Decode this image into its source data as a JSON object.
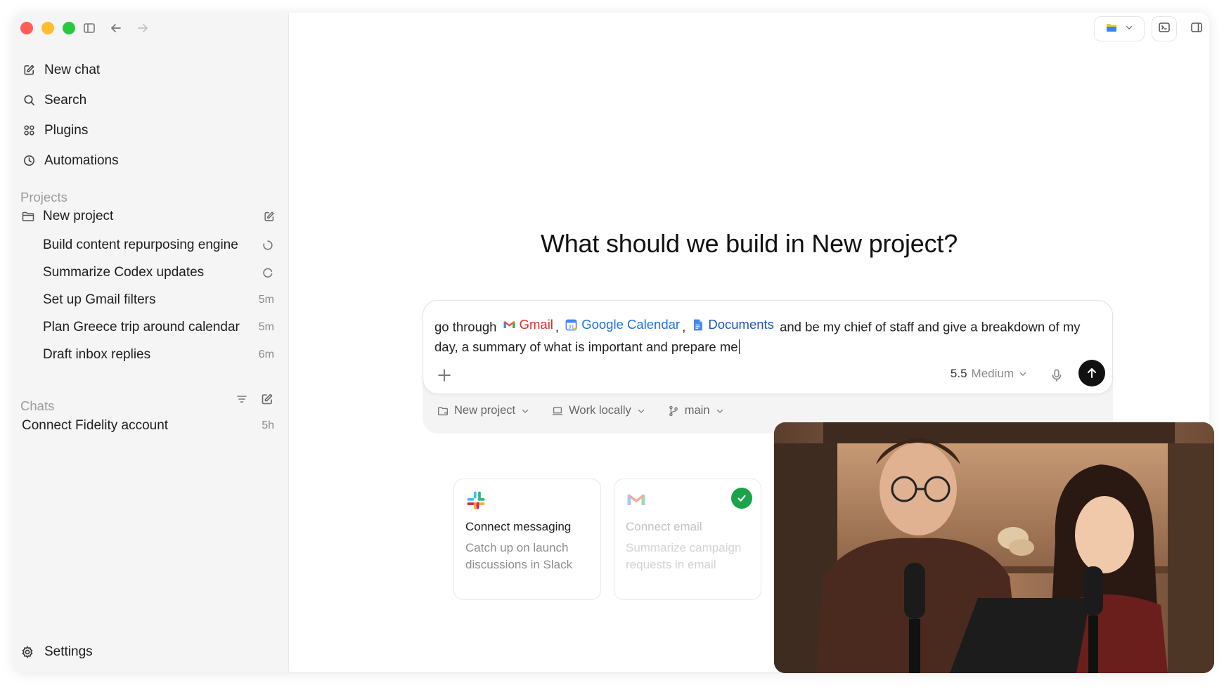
{
  "sidebar": {
    "nav": [
      {
        "label": "New chat",
        "icon": "compose-icon"
      },
      {
        "label": "Search",
        "icon": "search-icon"
      },
      {
        "label": "Plugins",
        "icon": "plugins-icon"
      },
      {
        "label": "Automations",
        "icon": "clock-icon"
      }
    ],
    "projects_label": "Projects",
    "project_name": "New project",
    "project_items": [
      {
        "label": "Build content repurposing engine",
        "meta": ""
      },
      {
        "label": "Summarize Codex updates",
        "meta": ""
      },
      {
        "label": "Set up Gmail filters",
        "meta": "5m"
      },
      {
        "label": "Plan Greece trip around calendar",
        "meta": "5m"
      },
      {
        "label": "Draft inbox replies",
        "meta": "6m"
      }
    ],
    "chats_label": "Chats",
    "chat_items": [
      {
        "label": "Connect Fidelity account",
        "meta": "5h"
      }
    ],
    "settings_label": "Settings"
  },
  "main": {
    "headline": "What should we build in New project?",
    "prompt": {
      "prefix": "go through",
      "gmail": "Gmail",
      "sep1": ",",
      "gcal": "Google Calendar",
      "sep2": ",",
      "docs": "Documents",
      "rest": "and be my chief of staff and give a breakdown of my day, a summary of what is important and prepare me"
    },
    "model_version": "5.5",
    "model_effort": "Medium",
    "options": {
      "project": "New project",
      "location": "Work locally",
      "branch": "main"
    },
    "cards": [
      {
        "title": "Connect messaging",
        "desc": "Catch up on launch discussions in Slack"
      },
      {
        "title": "Connect email",
        "desc": "Summarize campaign requests in email"
      }
    ]
  },
  "colors": {
    "gmail_red": "#d93025",
    "gcal_blue": "#1a73e8",
    "docs_blue": "#1a56c4",
    "check_green": "#1aa34a"
  }
}
